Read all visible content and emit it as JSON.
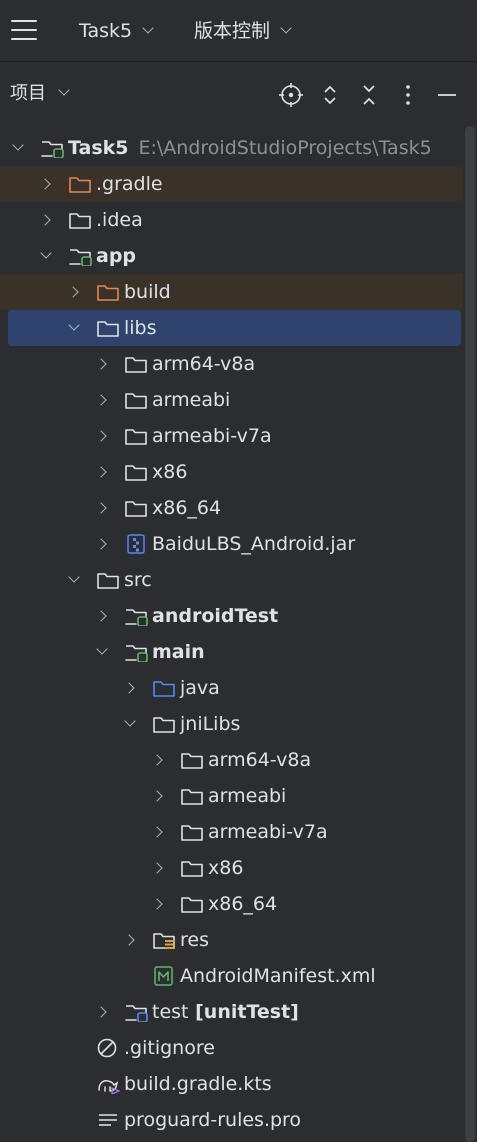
{
  "toolbar": {
    "project_name": "Task5",
    "vcs_label": "版本控制"
  },
  "panel": {
    "title": "项目",
    "icons": [
      "locate-icon",
      "expand-collapse-icon",
      "collapse-all-icon",
      "more-options-icon",
      "hide-icon"
    ]
  },
  "tree": [
    {
      "label": "Task5",
      "path": "E:\\AndroidStudioProjects\\Task5",
      "depth": 0,
      "arrow": "down",
      "icon": "module-folder",
      "bold": true,
      "state": ""
    },
    {
      "label": ".gradle",
      "depth": 1,
      "arrow": "right",
      "icon": "folder-excluded",
      "bold": false,
      "state": "excluded"
    },
    {
      "label": ".idea",
      "depth": 1,
      "arrow": "right",
      "icon": "folder",
      "bold": false,
      "state": ""
    },
    {
      "label": "app",
      "depth": 1,
      "arrow": "down",
      "icon": "module-folder",
      "bold": true,
      "state": ""
    },
    {
      "label": "build",
      "depth": 2,
      "arrow": "right",
      "icon": "folder-excluded",
      "bold": false,
      "state": "excluded"
    },
    {
      "label": "libs",
      "depth": 2,
      "arrow": "down",
      "icon": "folder",
      "bold": false,
      "state": "selected"
    },
    {
      "label": "arm64-v8a",
      "depth": 3,
      "arrow": "right",
      "icon": "folder",
      "bold": false,
      "state": ""
    },
    {
      "label": "armeabi",
      "depth": 3,
      "arrow": "right",
      "icon": "folder",
      "bold": false,
      "state": ""
    },
    {
      "label": "armeabi-v7a",
      "depth": 3,
      "arrow": "right",
      "icon": "folder",
      "bold": false,
      "state": ""
    },
    {
      "label": "x86",
      "depth": 3,
      "arrow": "right",
      "icon": "folder",
      "bold": false,
      "state": ""
    },
    {
      "label": "x86_64",
      "depth": 3,
      "arrow": "right",
      "icon": "folder",
      "bold": false,
      "state": ""
    },
    {
      "label": "BaiduLBS_Android.jar",
      "depth": 3,
      "arrow": "right",
      "icon": "jar",
      "bold": false,
      "state": ""
    },
    {
      "label": "src",
      "depth": 2,
      "arrow": "down",
      "icon": "folder",
      "bold": false,
      "state": ""
    },
    {
      "label": "androidTest",
      "depth": 3,
      "arrow": "right",
      "icon": "module-folder",
      "bold": true,
      "state": ""
    },
    {
      "label": "main",
      "depth": 3,
      "arrow": "down",
      "icon": "module-folder",
      "bold": true,
      "state": ""
    },
    {
      "label": "java",
      "depth": 4,
      "arrow": "right",
      "icon": "folder-source",
      "bold": false,
      "state": ""
    },
    {
      "label": "jniLibs",
      "depth": 4,
      "arrow": "down",
      "icon": "folder",
      "bold": false,
      "state": ""
    },
    {
      "label": "arm64-v8a",
      "depth": 5,
      "arrow": "right",
      "icon": "folder",
      "bold": false,
      "state": ""
    },
    {
      "label": "armeabi",
      "depth": 5,
      "arrow": "right",
      "icon": "folder",
      "bold": false,
      "state": ""
    },
    {
      "label": "armeabi-v7a",
      "depth": 5,
      "arrow": "right",
      "icon": "folder",
      "bold": false,
      "state": ""
    },
    {
      "label": "x86",
      "depth": 5,
      "arrow": "right",
      "icon": "folder",
      "bold": false,
      "state": ""
    },
    {
      "label": "x86_64",
      "depth": 5,
      "arrow": "right",
      "icon": "folder",
      "bold": false,
      "state": ""
    },
    {
      "label": "res",
      "depth": 4,
      "arrow": "right",
      "icon": "folder-resources",
      "bold": false,
      "state": ""
    },
    {
      "label": "AndroidManifest.xml",
      "depth": 4,
      "arrow": "none",
      "icon": "manifest",
      "bold": false,
      "state": ""
    },
    {
      "label": "test",
      "suffix": " [unitTest]",
      "depth": 3,
      "arrow": "right",
      "icon": "module-folder-test",
      "bold": false,
      "state": ""
    },
    {
      "label": ".gitignore",
      "depth": 2,
      "arrow": "none",
      "icon": "ignore",
      "bold": false,
      "state": ""
    },
    {
      "label": "build.gradle.kts",
      "depth": 2,
      "arrow": "none",
      "icon": "gradle",
      "bold": false,
      "state": ""
    },
    {
      "label": "proguard-rules.pro",
      "depth": 2,
      "arrow": "none",
      "icon": "text",
      "bold": false,
      "state": ""
    }
  ],
  "colors": {
    "background": "#2b2d30",
    "selection": "#2e436e",
    "excluded_row": "#3a3128",
    "excluded_folder": "#e08855",
    "source_folder": "#548af7",
    "module_badge": "#5fb865",
    "test_badge": "#548af7",
    "path_text": "#8c9199"
  }
}
